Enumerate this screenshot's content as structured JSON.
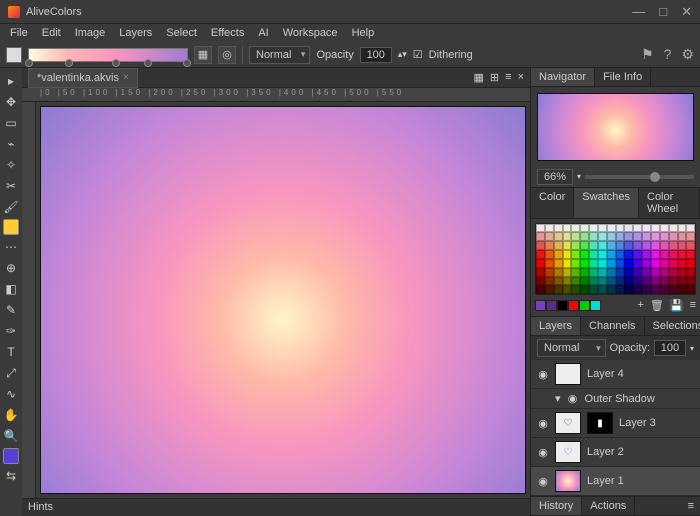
{
  "app": {
    "title": "AliveColors"
  },
  "menu": [
    "File",
    "Edit",
    "Image",
    "Layers",
    "Select",
    "Effects",
    "AI",
    "Workspace",
    "Help"
  ],
  "toolbar": {
    "blend_mode": "Normal",
    "opacity_label": "Opacity",
    "opacity_value": "100",
    "dithering": "Dithering",
    "gradient_stops": [
      0,
      25,
      55,
      75,
      100
    ]
  },
  "document": {
    "tab_name": "*valentinka.akvis"
  },
  "navigator": {
    "tabs": [
      "Navigator",
      "File Info"
    ],
    "zoom": "66%"
  },
  "color_panel": {
    "tabs": [
      "Color",
      "Swatches",
      "Color Wheel"
    ],
    "active": 1,
    "recent": [
      "#7b3fbf",
      "#5a2d8a",
      "#000000",
      "#ff0000",
      "#00cc00",
      "#00e0e0"
    ]
  },
  "layers_panel": {
    "tabs": [
      "Layers",
      "Channels",
      "Selections"
    ],
    "blend": "Normal",
    "opacity_label": "Opacity:",
    "opacity_value": "100",
    "layers": [
      {
        "name": "Layer 4",
        "visible": true,
        "thumb": "blank"
      },
      {
        "name": "Outer Shadow",
        "visible": true,
        "fx": true
      },
      {
        "name": "Layer 3",
        "visible": true,
        "thumb": "heart",
        "mask": true
      },
      {
        "name": "Layer 2",
        "visible": true,
        "thumb": "heart2"
      },
      {
        "name": "Layer 1",
        "visible": true,
        "thumb": "grad",
        "selected": true
      }
    ]
  },
  "history_panel": {
    "tabs": [
      "History",
      "Actions"
    ]
  },
  "hints_label": "Hints",
  "ruler_marks": "|0    |50    |100   |150   |200   |250   |300   |350   |400   |450   |500   |550"
}
